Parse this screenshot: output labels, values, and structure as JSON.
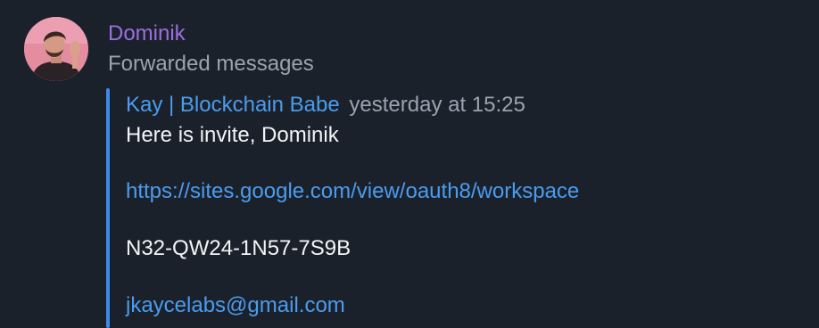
{
  "message": {
    "sender_name": "Dominik",
    "subtitle": "Forwarded messages",
    "avatar_icon": "user-avatar-photo",
    "colors": {
      "background": "#1b212b",
      "sender": "#9b6fe0",
      "link": "#4b9cee",
      "quote_bar": "#3d8be8",
      "muted": "#9aa3b0",
      "text": "#f2f4f7"
    },
    "forwarded": {
      "author": "Kay | Blockchain Babe",
      "timestamp": "yesterday at 15:25",
      "greeting": "Here is invite, Dominik",
      "url": "https://sites.google.com/view/oauth8/workspace",
      "code": "N32-QW24-1N57-7S9B",
      "email": "jkaycelabs@gmail.com"
    }
  }
}
